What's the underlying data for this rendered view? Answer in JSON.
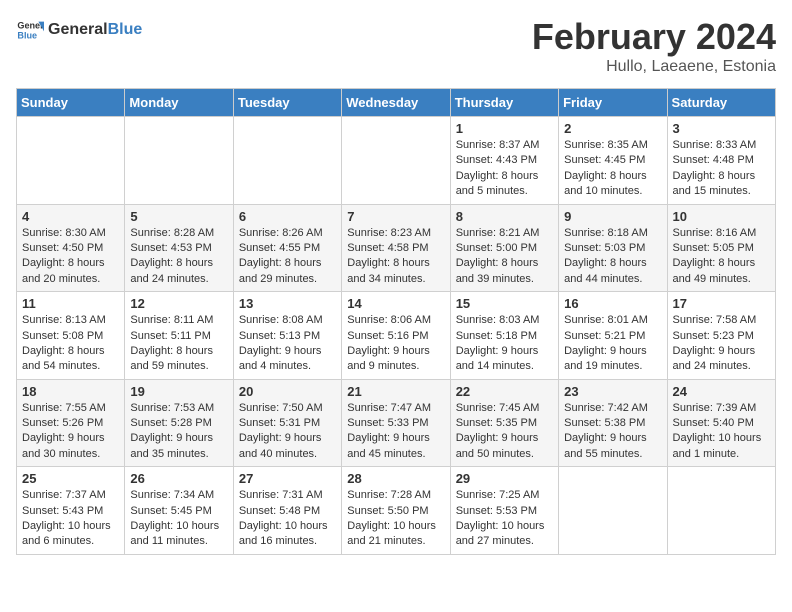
{
  "logo": {
    "general": "General",
    "blue": "Blue"
  },
  "title": "February 2024",
  "location": "Hullo, Laeaene, Estonia",
  "days_of_week": [
    "Sunday",
    "Monday",
    "Tuesday",
    "Wednesday",
    "Thursday",
    "Friday",
    "Saturday"
  ],
  "weeks": [
    [
      {
        "day": "",
        "info": ""
      },
      {
        "day": "",
        "info": ""
      },
      {
        "day": "",
        "info": ""
      },
      {
        "day": "",
        "info": ""
      },
      {
        "day": "1",
        "info": "Sunrise: 8:37 AM\nSunset: 4:43 PM\nDaylight: 8 hours\nand 5 minutes."
      },
      {
        "day": "2",
        "info": "Sunrise: 8:35 AM\nSunset: 4:45 PM\nDaylight: 8 hours\nand 10 minutes."
      },
      {
        "day": "3",
        "info": "Sunrise: 8:33 AM\nSunset: 4:48 PM\nDaylight: 8 hours\nand 15 minutes."
      }
    ],
    [
      {
        "day": "4",
        "info": "Sunrise: 8:30 AM\nSunset: 4:50 PM\nDaylight: 8 hours\nand 20 minutes."
      },
      {
        "day": "5",
        "info": "Sunrise: 8:28 AM\nSunset: 4:53 PM\nDaylight: 8 hours\nand 24 minutes."
      },
      {
        "day": "6",
        "info": "Sunrise: 8:26 AM\nSunset: 4:55 PM\nDaylight: 8 hours\nand 29 minutes."
      },
      {
        "day": "7",
        "info": "Sunrise: 8:23 AM\nSunset: 4:58 PM\nDaylight: 8 hours\nand 34 minutes."
      },
      {
        "day": "8",
        "info": "Sunrise: 8:21 AM\nSunset: 5:00 PM\nDaylight: 8 hours\nand 39 minutes."
      },
      {
        "day": "9",
        "info": "Sunrise: 8:18 AM\nSunset: 5:03 PM\nDaylight: 8 hours\nand 44 minutes."
      },
      {
        "day": "10",
        "info": "Sunrise: 8:16 AM\nSunset: 5:05 PM\nDaylight: 8 hours\nand 49 minutes."
      }
    ],
    [
      {
        "day": "11",
        "info": "Sunrise: 8:13 AM\nSunset: 5:08 PM\nDaylight: 8 hours\nand 54 minutes."
      },
      {
        "day": "12",
        "info": "Sunrise: 8:11 AM\nSunset: 5:11 PM\nDaylight: 8 hours\nand 59 minutes."
      },
      {
        "day": "13",
        "info": "Sunrise: 8:08 AM\nSunset: 5:13 PM\nDaylight: 9 hours\nand 4 minutes."
      },
      {
        "day": "14",
        "info": "Sunrise: 8:06 AM\nSunset: 5:16 PM\nDaylight: 9 hours\nand 9 minutes."
      },
      {
        "day": "15",
        "info": "Sunrise: 8:03 AM\nSunset: 5:18 PM\nDaylight: 9 hours\nand 14 minutes."
      },
      {
        "day": "16",
        "info": "Sunrise: 8:01 AM\nSunset: 5:21 PM\nDaylight: 9 hours\nand 19 minutes."
      },
      {
        "day": "17",
        "info": "Sunrise: 7:58 AM\nSunset: 5:23 PM\nDaylight: 9 hours\nand 24 minutes."
      }
    ],
    [
      {
        "day": "18",
        "info": "Sunrise: 7:55 AM\nSunset: 5:26 PM\nDaylight: 9 hours\nand 30 minutes."
      },
      {
        "day": "19",
        "info": "Sunrise: 7:53 AM\nSunset: 5:28 PM\nDaylight: 9 hours\nand 35 minutes."
      },
      {
        "day": "20",
        "info": "Sunrise: 7:50 AM\nSunset: 5:31 PM\nDaylight: 9 hours\nand 40 minutes."
      },
      {
        "day": "21",
        "info": "Sunrise: 7:47 AM\nSunset: 5:33 PM\nDaylight: 9 hours\nand 45 minutes."
      },
      {
        "day": "22",
        "info": "Sunrise: 7:45 AM\nSunset: 5:35 PM\nDaylight: 9 hours\nand 50 minutes."
      },
      {
        "day": "23",
        "info": "Sunrise: 7:42 AM\nSunset: 5:38 PM\nDaylight: 9 hours\nand 55 minutes."
      },
      {
        "day": "24",
        "info": "Sunrise: 7:39 AM\nSunset: 5:40 PM\nDaylight: 10 hours\nand 1 minute."
      }
    ],
    [
      {
        "day": "25",
        "info": "Sunrise: 7:37 AM\nSunset: 5:43 PM\nDaylight: 10 hours\nand 6 minutes."
      },
      {
        "day": "26",
        "info": "Sunrise: 7:34 AM\nSunset: 5:45 PM\nDaylight: 10 hours\nand 11 minutes."
      },
      {
        "day": "27",
        "info": "Sunrise: 7:31 AM\nSunset: 5:48 PM\nDaylight: 10 hours\nand 16 minutes."
      },
      {
        "day": "28",
        "info": "Sunrise: 7:28 AM\nSunset: 5:50 PM\nDaylight: 10 hours\nand 21 minutes."
      },
      {
        "day": "29",
        "info": "Sunrise: 7:25 AM\nSunset: 5:53 PM\nDaylight: 10 hours\nand 27 minutes."
      },
      {
        "day": "",
        "info": ""
      },
      {
        "day": "",
        "info": ""
      }
    ]
  ]
}
